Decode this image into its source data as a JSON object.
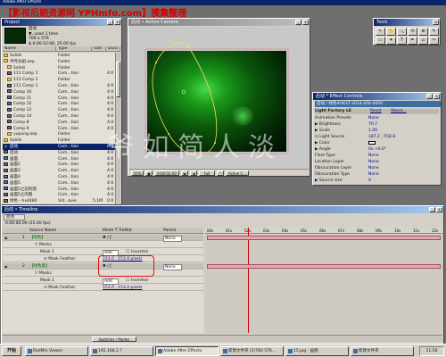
{
  "colors": {
    "app_title_bg": "#0a246a",
    "watermark_red": "#d40000",
    "selection_red": "#e01010",
    "mask_yellow": "#f0e060",
    "viewer_green": "#0c5a0c"
  },
  "app": {
    "title": "Adobe After Effects"
  },
  "watermark": "【影视后期资源网 YPHmfo.com】搜集整理",
  "big_watermark": "爷 如 简 人 淡",
  "project": {
    "title": "Project",
    "thumb_name": "后动",
    "thumb_info": [
      "▼, used 1 time",
      "700 x 576",
      "Δ 0:00:12:00, 25.00 fps"
    ],
    "headers": {
      "name": "Name",
      "type": "Type",
      "size": "Size",
      "dur": "Dura"
    },
    "items": [
      {
        "name": "Solids",
        "type": "Folder",
        "size": "",
        "dur": "",
        "icon": "folder",
        "indent": 0
      },
      {
        "name": "半月光组.aep",
        "type": "Folder",
        "size": "",
        "dur": "",
        "icon": "folder",
        "indent": 0
      },
      {
        "name": "Solids",
        "type": "Folder",
        "size": "",
        "dur": "",
        "icon": "folder",
        "indent": 1
      },
      {
        "name": "111 Comp 1",
        "type": "Com...tion",
        "size": "",
        "dur": "4:0",
        "icon": "comp",
        "indent": 1
      },
      {
        "name": "111 Comp 1",
        "type": "Folder",
        "size": "",
        "dur": "",
        "icon": "folder",
        "indent": 1
      },
      {
        "name": "111 Comp 1",
        "type": "Com...tion",
        "size": "",
        "dur": "4:0",
        "icon": "comp",
        "indent": 1
      },
      {
        "name": "Comp 10",
        "type": "Com...tion",
        "size": "",
        "dur": "4:0",
        "icon": "comp",
        "indent": 1
      },
      {
        "name": "Comp 11",
        "type": "Com...tion",
        "size": "",
        "dur": "4:0",
        "icon": "comp",
        "indent": 1
      },
      {
        "name": "Comp 12",
        "type": "Com...tion",
        "size": "",
        "dur": "4:0",
        "icon": "comp",
        "indent": 1
      },
      {
        "name": "Comp 13",
        "type": "Com...tion",
        "size": "",
        "dur": "4:0",
        "icon": "comp",
        "indent": 1
      },
      {
        "name": "Comp 14",
        "type": "Com...tion",
        "size": "",
        "dur": "4:0",
        "icon": "comp",
        "indent": 1
      },
      {
        "name": "Comp 8",
        "type": "Com...tion",
        "size": "",
        "dur": "4:0",
        "icon": "comp",
        "indent": 1
      },
      {
        "name": "Comp 9",
        "type": "Com...tion",
        "size": "",
        "dur": "4:0",
        "icon": "comp",
        "indent": 1
      },
      {
        "name": "yupung.aep",
        "type": "Folder",
        "size": "",
        "dur": "",
        "icon": "folder",
        "indent": 1
      },
      {
        "name": "Solids",
        "type": "Folder",
        "size": "",
        "dur": "",
        "icon": "folder",
        "indent": 0
      },
      {
        "name": "后动",
        "type": "Com...tion",
        "size": "",
        "dur": "0:0",
        "icon": "comp",
        "indent": 0,
        "selected": true
      },
      {
        "name": "后动",
        "type": "Com...tion",
        "size": "",
        "dur": "4:0",
        "icon": "comp",
        "indent": 0
      },
      {
        "name": "画面",
        "type": "Com...tion",
        "size": "",
        "dur": "4:0",
        "icon": "comp",
        "indent": 0
      },
      {
        "name": "画面2",
        "type": "Com...tion",
        "size": "",
        "dur": "4:0",
        "icon": "comp",
        "indent": 0
      },
      {
        "name": "画面3",
        "type": "Com...tion",
        "size": "",
        "dur": "4:0",
        "icon": "comp",
        "indent": 0
      },
      {
        "name": "画面4",
        "type": "Com...tion",
        "size": "",
        "dur": "4:0",
        "icon": "comp",
        "indent": 0
      },
      {
        "name": "画面5",
        "type": "Com...tion",
        "size": "",
        "dur": "4:0",
        "icon": "comp",
        "indent": 0
      },
      {
        "name": "画面5之前的图",
        "type": "Com...tion",
        "size": "",
        "dur": "4:0",
        "icon": "comp",
        "indent": 0
      },
      {
        "name": "画面5之的图",
        "type": "Com...tion",
        "size": "",
        "dur": "4:0",
        "icon": "comp",
        "indent": 0
      },
      {
        "name": "绿色 - hx4480",
        "type": "Vid...ovie",
        "size": "5.1M",
        "dur": "0:0",
        "icon": "still",
        "indent": 0
      }
    ]
  },
  "composition": {
    "title": "后动 • Active Camera",
    "zoom": "50%",
    "timecode": "0:00:02:00",
    "resolution": "Full",
    "camera": "Active C..."
  },
  "tools": {
    "title": "Tools",
    "glyphs": [
      "↖",
      "✋",
      "🔍",
      "⟲",
      "⊕",
      "✎",
      "▭",
      "✦",
      "T",
      "✒",
      "⌂",
      "✂"
    ]
  },
  "effects": {
    "title": "后动 * Effect Controls",
    "tab": "后动 / 绿色#d437-2014-42b-4450",
    "effect_name": "Light Factory LE",
    "reset": "Reset",
    "about": "About...",
    "props": [
      {
        "label": "Animation Presets",
        "value": "None"
      },
      {
        "label": "▶ Brightness",
        "value": "70.7"
      },
      {
        "label": "▶ Scale",
        "value": "1.00"
      },
      {
        "label": "⊙ Light Source",
        "value": "187.2 , 558.8"
      },
      {
        "label": "▶ Color",
        "value": ""
      },
      {
        "label": "▶ Angle",
        "value": "0x +0.0°"
      },
      {
        "label": "Flare Type",
        "value": "None"
      },
      {
        "label": "Location Layer",
        "value": "None"
      },
      {
        "label": "Obscuration Layer",
        "value": "None"
      },
      {
        "label": "Obscuration Type",
        "value": "None"
      },
      {
        "label": "▶ Source size",
        "value": "0"
      }
    ]
  },
  "timeline": {
    "title": "后动 • Timeline",
    "tab": "后动",
    "timecode": "0:00:00:00 (25.00 fps)",
    "headers": {
      "source": "Source Name",
      "modes": "Mode T TrkMat",
      "parent": "Parent"
    },
    "ruler": [
      "00s",
      "01s",
      "02s",
      "03s",
      "04s",
      "05s",
      "06s",
      "07s",
      "08s",
      "09s",
      "10s",
      "11s",
      "12s"
    ],
    "rows": [
      {
        "num": "1",
        "name": "【绿色】",
        "kind": "layer",
        "parent": "None"
      },
      {
        "num": "",
        "name": "▽ Masks",
        "kind": "group"
      },
      {
        "num": "",
        "name": "Mask 1",
        "kind": "mask",
        "mode": "Add",
        "inv": "Inverted"
      },
      {
        "num": "",
        "name": "⊙ Mask Feather",
        "kind": "prop",
        "value": "153.0 , 153.0 pixels"
      },
      {
        "num": "2",
        "name": "【绿色底】",
        "kind": "layer",
        "parent": "None"
      },
      {
        "num": "",
        "name": "▽ Masks",
        "kind": "group"
      },
      {
        "num": "",
        "name": "Mask 1",
        "kind": "mask",
        "mode": "Add",
        "inv": "Inverted"
      },
      {
        "num": "",
        "name": "⊙ Mask Feather",
        "kind": "prop",
        "value": "153.0 , 153.0 pixels"
      }
    ],
    "footer": "Switches / Modes"
  },
  "taskbar": {
    "start": "开始",
    "items": [
      "RadMin Viewer",
      "192.168.2.?",
      "Adobe After Effects",
      "新建文件夹 (2)760 576...",
      "15.jpg - 画图",
      "新建文件夹"
    ],
    "clock": "11:56"
  }
}
